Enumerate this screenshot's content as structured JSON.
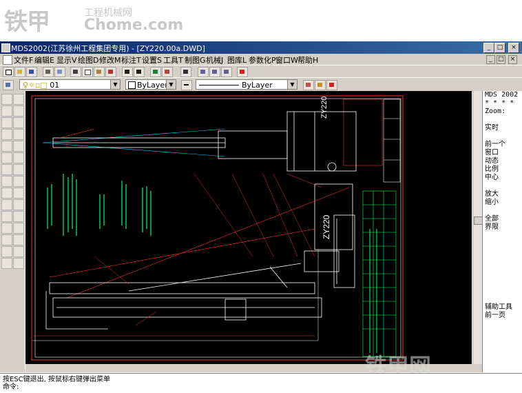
{
  "watermark": {
    "cn": "铁甲",
    "site_cn": "工程机械网",
    "site_en": "Chome.com",
    "bottom": "铁甲网"
  },
  "window": {
    "title": "MDS2002(江苏徐州工程集团专用) - [ZY220.00a.DWD]",
    "controls": [
      "_",
      "□",
      "×"
    ],
    "mdi_controls": [
      "_",
      "□",
      "×"
    ]
  },
  "menu": [
    "文件F",
    "编辑E",
    "显示V",
    "绘图D",
    "修改M",
    "标注T",
    "设置S",
    "工具T",
    "制图G",
    "机械J",
    "图库L",
    "参数化P",
    "窗口W",
    "帮助H"
  ],
  "layer": {
    "current": "01",
    "color": "ByLayer",
    "linetype": "ByLayer"
  },
  "side_menu": [
    "MDS 2002",
    "* * * *",
    "Zoom:",
    "",
    "实时",
    "",
    "前一个",
    "窗口",
    "动态",
    "比例",
    "中心",
    "",
    "放大",
    "缩小",
    "",
    "全部",
    "界限",
    "",
    "",
    "",
    "",
    "",
    "",
    "",
    "",
    "",
    "辅助工具",
    "前一页"
  ],
  "command": {
    "line1": "按ESC键退出, 按鼠标右键弹出菜单",
    "line2": "命令:"
  },
  "colors": {
    "title_bar": "#0a246a",
    "canvas": "#000000",
    "drawing_white": "#ffffff",
    "drawing_green": "#00ff66",
    "drawing_red": "#ff3030",
    "drawing_cyan": "#00c8ff"
  },
  "drawing_labels": {
    "crane_upper": "ZY220",
    "crane_lower": "ZY220"
  }
}
